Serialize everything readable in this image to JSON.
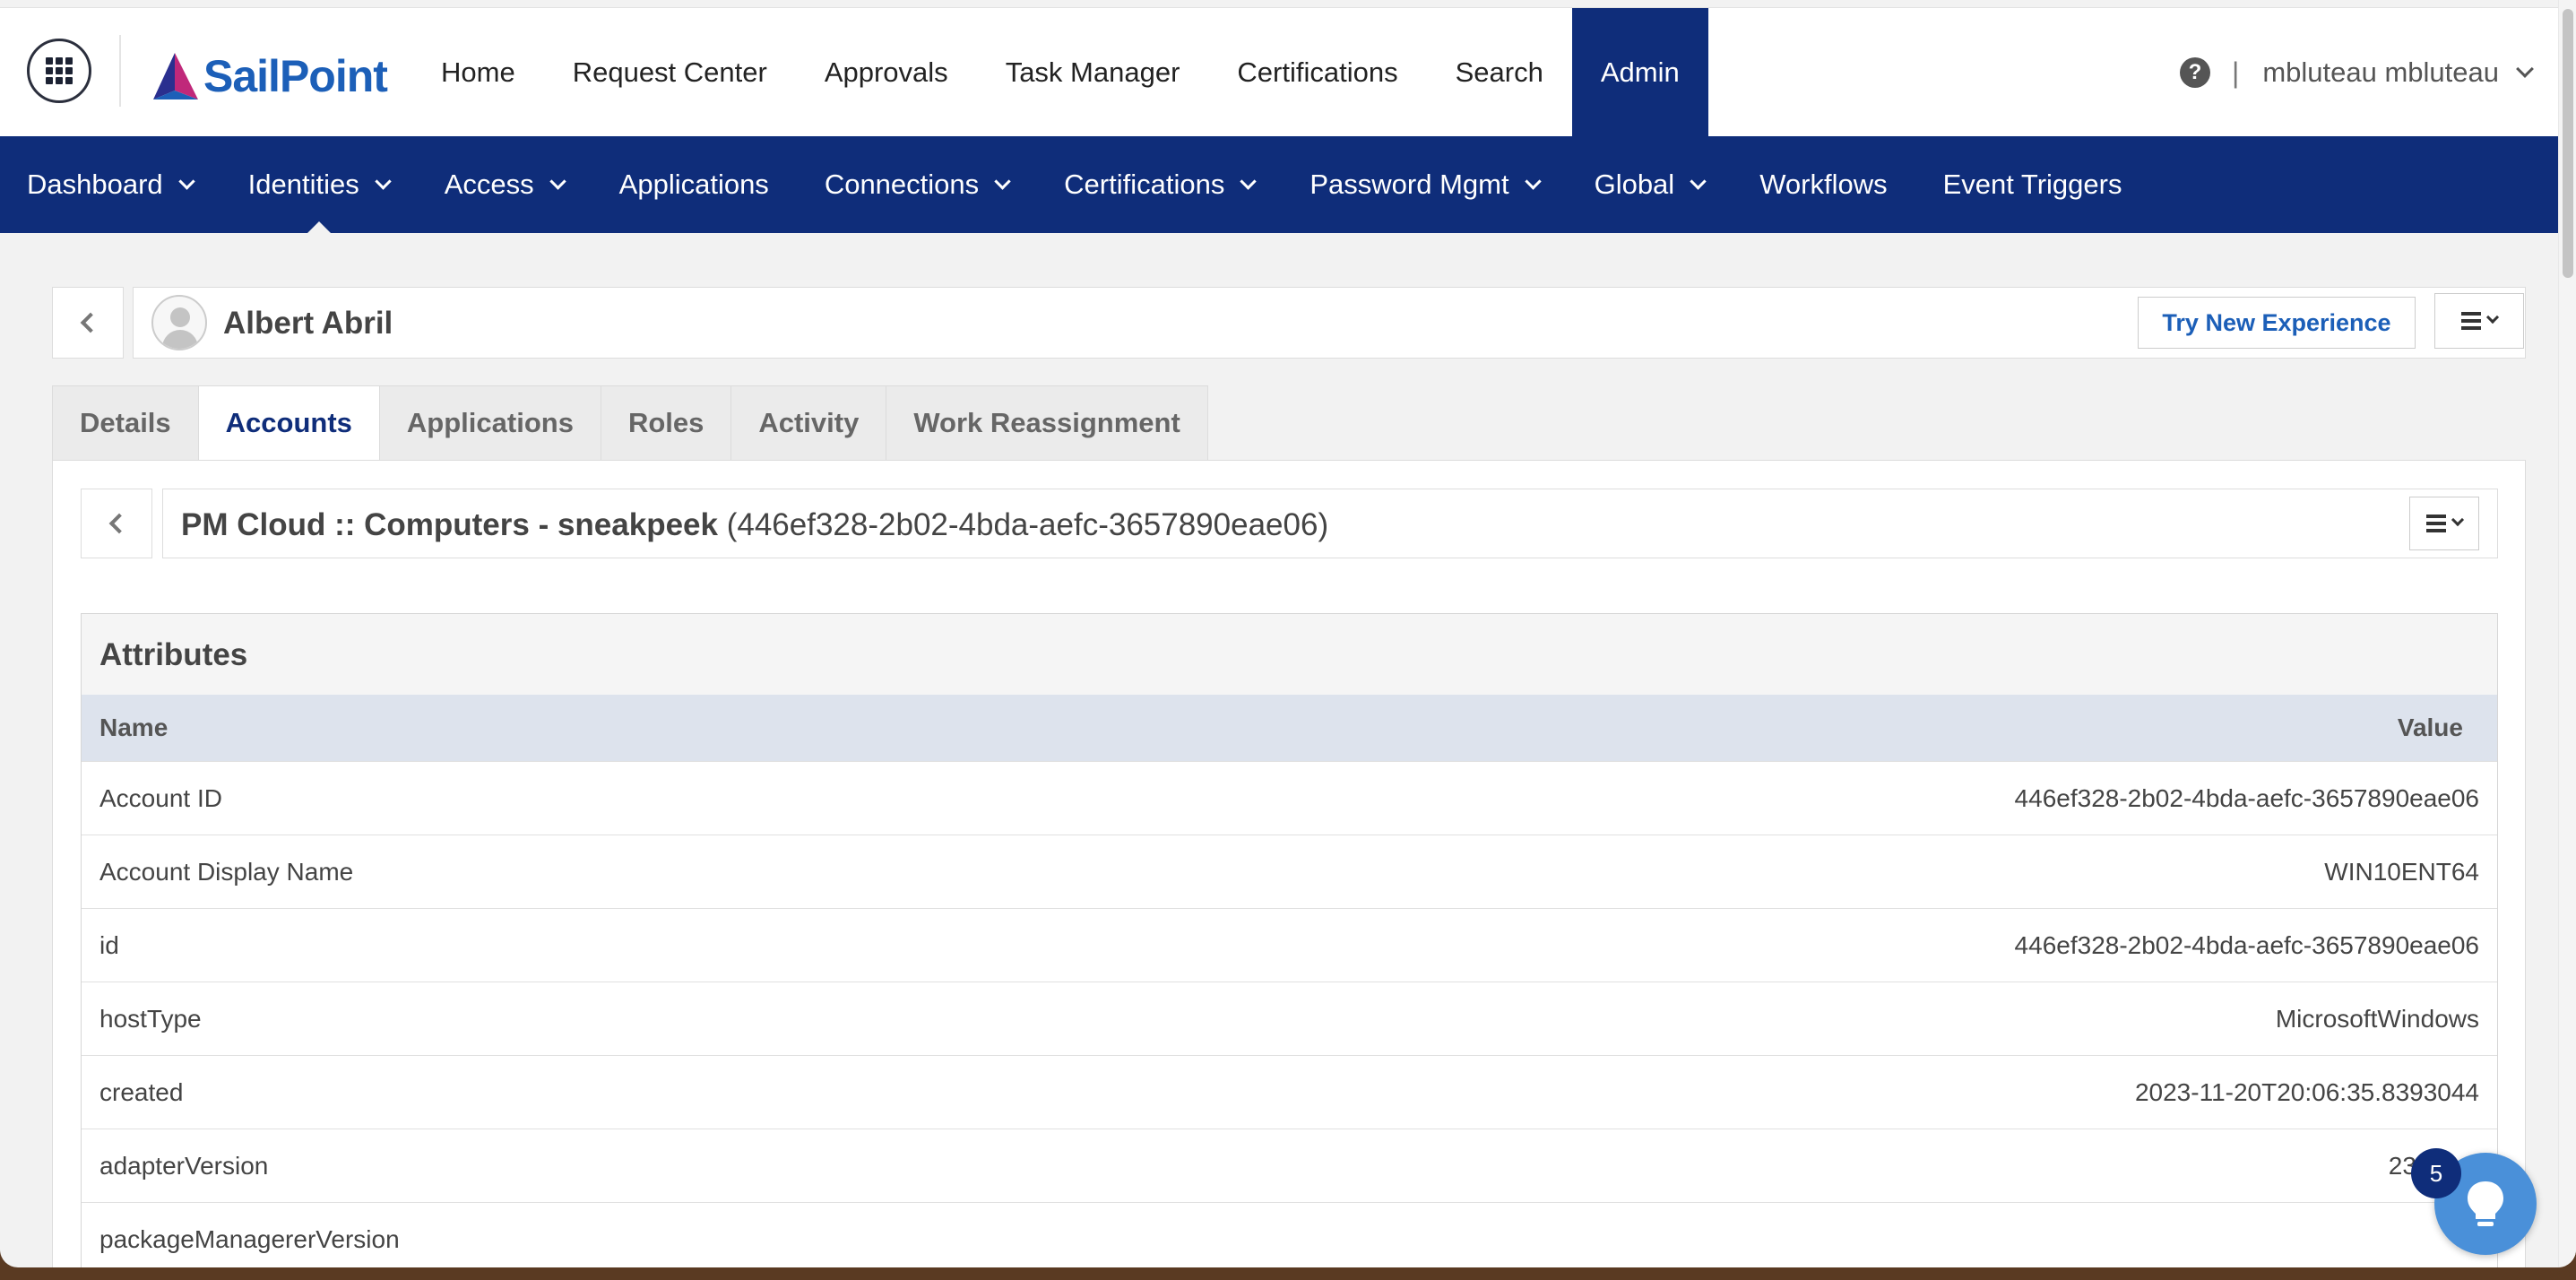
{
  "brand": {
    "logo_text": "SailPoint",
    "color": "#1c5fb8"
  },
  "topnav": {
    "items": [
      {
        "label": "Home"
      },
      {
        "label": "Request Center"
      },
      {
        "label": "Approvals"
      },
      {
        "label": "Task Manager"
      },
      {
        "label": "Certifications"
      },
      {
        "label": "Search"
      },
      {
        "label": "Admin",
        "active": true
      }
    ],
    "help_icon": "question-circle-icon",
    "separator": "|",
    "user": "mbluteau mbluteau"
  },
  "adminnav": {
    "items": [
      {
        "label": "Dashboard",
        "dropdown": true
      },
      {
        "label": "Identities",
        "dropdown": true,
        "active": true
      },
      {
        "label": "Access",
        "dropdown": true
      },
      {
        "label": "Applications",
        "dropdown": false
      },
      {
        "label": "Connections",
        "dropdown": true
      },
      {
        "label": "Certifications",
        "dropdown": true
      },
      {
        "label": "Password Mgmt",
        "dropdown": true
      },
      {
        "label": "Global",
        "dropdown": true
      },
      {
        "label": "Workflows",
        "dropdown": false
      },
      {
        "label": "Event Triggers",
        "dropdown": false
      }
    ],
    "color": "#0f2d7a"
  },
  "identity": {
    "name": "Albert Abril",
    "try_new_experience": "Try New Experience"
  },
  "tabs": [
    {
      "label": "Details"
    },
    {
      "label": "Accounts",
      "active": true
    },
    {
      "label": "Applications"
    },
    {
      "label": "Roles"
    },
    {
      "label": "Activity"
    },
    {
      "label": "Work Reassignment"
    }
  ],
  "account": {
    "name": "PM Cloud :: Computers - sneakpeek",
    "id": "(446ef328-2b02-4bda-aefc-3657890eae06)"
  },
  "attributes": {
    "title": "Attributes",
    "col_name": "Name",
    "col_value": "Value",
    "rows": [
      {
        "name": "Account ID",
        "value": "446ef328-2b02-4bda-aefc-3657890eae06"
      },
      {
        "name": "Account Display Name",
        "value": "WIN10ENT64"
      },
      {
        "name": "id",
        "value": "446ef328-2b02-4bda-aefc-3657890eae06"
      },
      {
        "name": "hostType",
        "value": "MicrosoftWindows"
      },
      {
        "name": "created",
        "value": "2023-11-20T20:06:35.8393044"
      },
      {
        "name": "adapterVersion",
        "value": "23.9.0.0"
      },
      {
        "name": "packageManagererVersion",
        "value": ""
      }
    ]
  },
  "help_widget": {
    "badge_count": "5",
    "icon": "lightbulb-icon"
  }
}
